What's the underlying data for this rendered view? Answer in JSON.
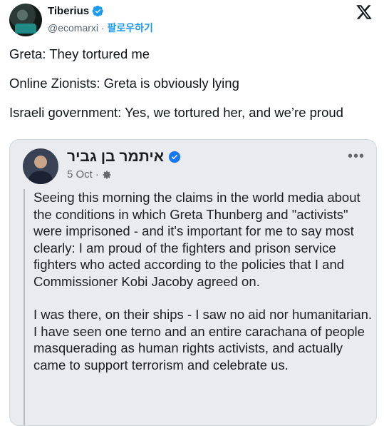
{
  "tweet": {
    "author_name": "Tiberius",
    "handle": "@ecomarxi",
    "separator": " · ",
    "follow_label": "팔로우하기",
    "lines": [
      "Greta: They tortured me",
      "Online Zionists: Greta is obviously lying",
      "Israeli government: Yes, we tortured her, and we’re proud"
    ]
  },
  "embedded_post": {
    "author_name": "איתמר בן גביר",
    "date": "5 Oct",
    "date_separator": "·",
    "more_label": "•••",
    "paragraphs": [
      "Seeing this morning the claims in the world media about the conditions in which Greta Thunberg and \"activists\" were imprisoned - and it's important for me to say most clearly: I am proud of the fighters and prison service fighters who acted according to the policies that I and Commissioner Kobi Jacoby agreed on.",
      "I was there, on their ships - I saw no aid nor humanitarian. I have seen one terno and an entire carachana of people masquerading as human rights activists, and actually came to support terrorism and celebrate us."
    ]
  },
  "colors": {
    "verified": "#1d9bf0",
    "follow": "#1d9bf0",
    "fb_verified": "#1877f2"
  }
}
